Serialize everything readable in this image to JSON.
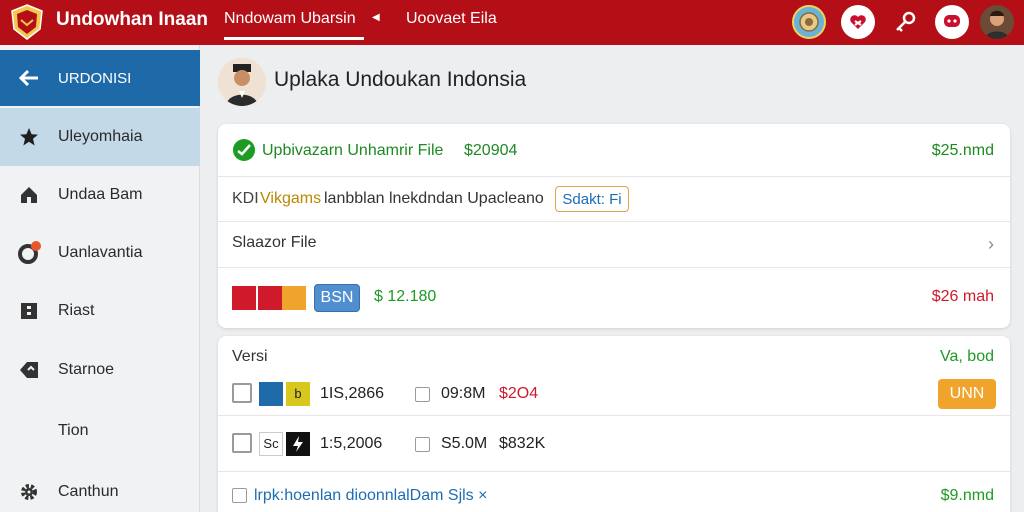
{
  "header": {
    "app_title": "Undowhan Inaan",
    "tabs": [
      {
        "label": "Nndowam Ubarsin",
        "active": true
      },
      {
        "label": "Uoovaet Eila",
        "active": false
      }
    ]
  },
  "sidebar": {
    "items": [
      {
        "label": "URDONISI",
        "icon": "arrow-left-icon"
      },
      {
        "label": "Uleyomhaia",
        "icon": "star-icon"
      },
      {
        "label": "Undaa Bam",
        "icon": "home-icon"
      },
      {
        "label": "Uanlavantia",
        "icon": "refresh-icon"
      },
      {
        "label": "Riast",
        "icon": "document-icon"
      },
      {
        "label": "Starnoe",
        "icon": "tag-icon"
      },
      {
        "label": "Tion",
        "icon": ""
      },
      {
        "label": "Canthun",
        "icon": "gear-icon"
      }
    ]
  },
  "main": {
    "title": "Uplaka Undoukan Indonsia",
    "card1": {
      "row1": {
        "label": "Upbivazarn Unhamrir File",
        "amount": "$20904",
        "right_value": "$25.nmd"
      },
      "row2": {
        "prefix": "KDI",
        "highlight": "Vikgams",
        "text": "lanbblan lnekdndan Upacleano",
        "badge": "Sdakt: Fi"
      },
      "row3": {
        "label": "Slaazor File"
      },
      "row4": {
        "badge": "BSN",
        "amount": "$ 12.180",
        "right_value": "$26 mah"
      }
    },
    "card2": {
      "header": {
        "label": "Versi",
        "right_value": "Va, bod"
      },
      "rows": [
        {
          "icon_text": "b",
          "version": "1IS,2866",
          "size": "09:8M",
          "price": "$2O4",
          "action": "UNN"
        },
        {
          "icon_text": "Sc",
          "version": "1:5,2006",
          "size": "S5.0M",
          "price": "$832K"
        }
      ],
      "footer": {
        "text": "lrpk:hoenlan dioonnlalDam Sjls ×",
        "right_value": "$9.nmd"
      }
    }
  },
  "colors": {
    "brand_red": "#b40f17",
    "sidebar_selected": "#c4d9e8",
    "back_blue": "#1e6aa8",
    "green": "#1d9b22",
    "red": "#d01a2b",
    "orange_button": "#f0a42c",
    "badge_blue": "#4f8fcf"
  }
}
